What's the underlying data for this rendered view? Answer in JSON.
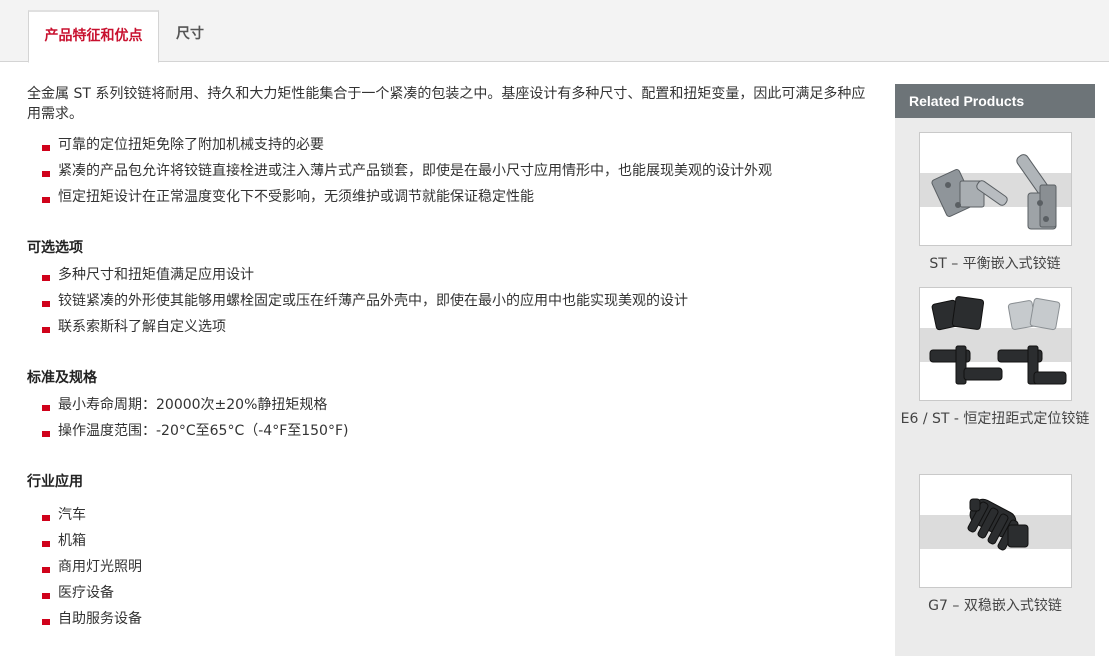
{
  "tabs": [
    {
      "label": "产品特征和优点",
      "active": true
    },
    {
      "label": "尺寸",
      "active": false
    }
  ],
  "intro": "全金属 ST 系列铰链将耐用、持久和大力矩性能集合于一个紧凑的包装之中。基座设计有多种尺寸、配置和扭矩变量，因此可满足多种应用需求。",
  "features": [
    "可靠的定位扭矩免除了附加机械支持的必要",
    "紧凑的产品包允许将铰链直接栓进或注入薄片式产品锁套，即使是在最小尺寸应用情形中，也能展现美观的设计外观",
    "恒定扭矩设计在正常温度变化下不受影响，无须维护或调节就能保证稳定性能"
  ],
  "options": {
    "title": "可选选项",
    "items": [
      "多种尺寸和扭矩值满足应用设计",
      "铰链紧凑的外形使其能够用螺栓固定或压在纤薄产品外壳中，即使在最小的应用中也能实现美观的设计",
      "联系索斯科了解自定义选项"
    ]
  },
  "standards": {
    "title": "标准及规格",
    "items": [
      "最小寿命周期：20000次±20%静扭矩规格",
      "操作温度范围：-20°C至65°C（-4°F至150°F)"
    ]
  },
  "industries": {
    "title": "行业应用",
    "items": [
      "汽车",
      "机箱",
      "商用灯光照明",
      "医疗设备",
      "自助服务设备"
    ]
  },
  "sidebar": {
    "header": "Related Products",
    "products": [
      {
        "caption": "ST – 平衡嵌入式铰链",
        "image": "silver-hinge-pair-image"
      },
      {
        "caption": "E6 / ST - 恒定扭距式定位铰链",
        "image": "black-and-silver-hinges-image"
      },
      {
        "caption": "G7 – 双稳嵌入式铰链",
        "image": "black-spring-hinge-image"
      }
    ]
  },
  "colors": {
    "accent": "#c8102e",
    "bullet": "#d0021b",
    "sidebar_header": "#6d7478",
    "sidebar_bg": "#ebebeb"
  }
}
